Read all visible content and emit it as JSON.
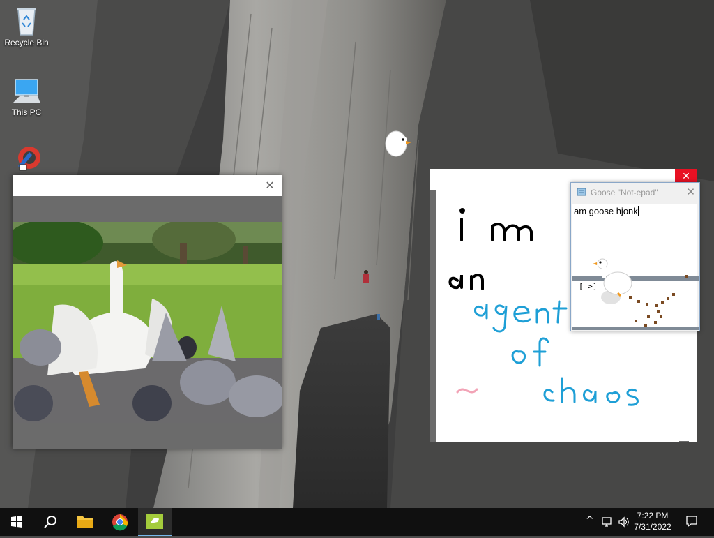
{
  "desktop": {
    "icons": [
      {
        "label": "Recycle Bin",
        "icon": "recycle-bin-icon"
      },
      {
        "label": "This PC",
        "icon": "this-pc-icon"
      },
      {
        "label": "",
        "icon": "ccleaner-shortcut-icon"
      }
    ]
  },
  "viewer_window": {
    "title": "",
    "close_symbol": "✕",
    "image": "goose-chasing-pigeons-photo"
  },
  "drawing_window": {
    "close_symbol": "✕",
    "handwriting": {
      "line1": "i m",
      "line2": "an",
      "line3": "agent",
      "line4": "of",
      "line5": "chaos",
      "squiggle": "~"
    },
    "colors": {
      "black_ink": "#000000",
      "blue_ink": "#1e9fd6",
      "pink_ink": "#f2a3b6"
    }
  },
  "notepad": {
    "title": "Goose \"Not-epad\"",
    "close_symbol": "✕",
    "text": "am goose hjonk",
    "status_glyph": "[ >]"
  },
  "taskbar": {
    "apps": [
      {
        "name": "start",
        "icon": "windows-start-icon"
      },
      {
        "name": "search",
        "icon": "search-icon"
      },
      {
        "name": "file-explorer",
        "icon": "folder-icon"
      },
      {
        "name": "chrome",
        "icon": "chrome-icon"
      },
      {
        "name": "desktop-goose",
        "icon": "goose-app-icon",
        "active": true
      }
    ],
    "tray": {
      "chevron": "^",
      "clock_time": "7:22 PM",
      "clock_date": "7/31/2022"
    }
  },
  "accent": "#76b9ed"
}
